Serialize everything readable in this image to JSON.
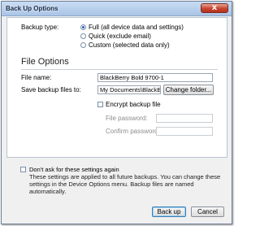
{
  "window": {
    "title": "Back Up Options",
    "close_label": "x"
  },
  "backup_type": {
    "label": "Backup type:",
    "options": [
      {
        "label": "Full (all device data and settings)",
        "selected": true
      },
      {
        "label": "Quick (exclude email)",
        "selected": false
      },
      {
        "label": "Custom (selected data only)",
        "selected": false
      }
    ]
  },
  "file_options": {
    "title": "File Options",
    "file_name_label": "File name:",
    "file_name_value": "BlackBerry Bold 9700-1",
    "save_to_label": "Save backup files to:",
    "save_to_value": "My Documents\\BlackBerr",
    "change_folder_label": "Change folder...",
    "encrypt_label": "Encrypt backup file",
    "encrypt_checked": false,
    "file_password_label": "File password:",
    "confirm_password_label": "Confirm password:"
  },
  "footer": {
    "dont_ask_label": "Don't ask for these settings again",
    "dont_ask_checked": false,
    "note": "These settings are applied to all future backups. You can change these settings in the Device Options menu. Backup files are named automatically.",
    "back_up_label": "Back up",
    "cancel_label": "Cancel"
  },
  "colors": {
    "accent": "#1f5fbf",
    "titlebar": "#a9c4e6",
    "close": "#c7452f"
  }
}
